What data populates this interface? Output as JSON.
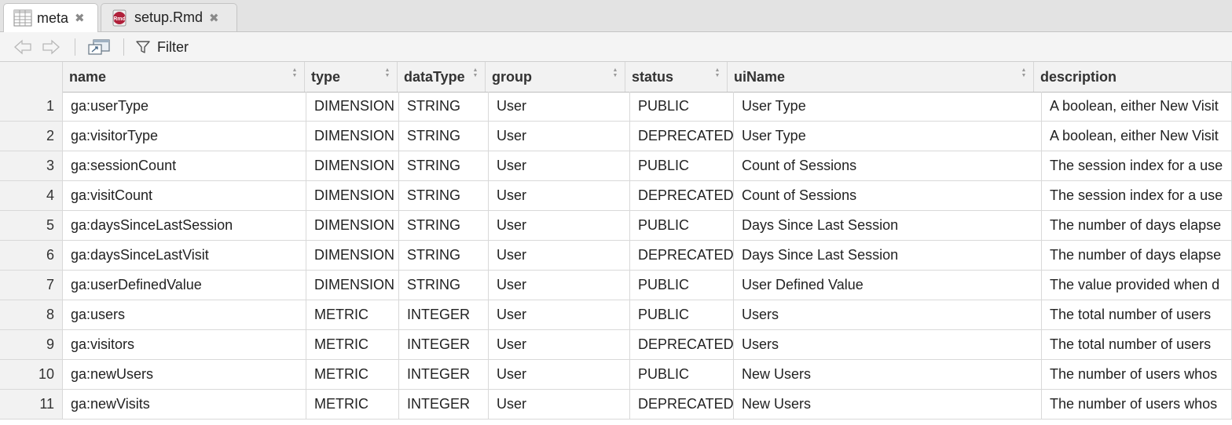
{
  "tabs": [
    {
      "label": "meta",
      "icon": "table-icon",
      "active": true
    },
    {
      "label": "setup.Rmd",
      "icon": "rmd-file-icon",
      "active": false
    }
  ],
  "toolbar": {
    "back_icon": "back-arrow-icon",
    "forward_icon": "forward-arrow-icon",
    "popout_icon": "popout-window-icon",
    "filter_label": "Filter"
  },
  "table": {
    "columns": [
      "name",
      "type",
      "dataType",
      "group",
      "status",
      "uiName",
      "description"
    ],
    "rows": [
      {
        "num": "1",
        "name": "ga:userType",
        "type": "DIMENSION",
        "dataType": "STRING",
        "group": "User",
        "status": "PUBLIC",
        "uiName": "User Type",
        "description": "A boolean, either New Visit"
      },
      {
        "num": "2",
        "name": "ga:visitorType",
        "type": "DIMENSION",
        "dataType": "STRING",
        "group": "User",
        "status": "DEPRECATED",
        "uiName": "User Type",
        "description": "A boolean, either New Visit"
      },
      {
        "num": "3",
        "name": "ga:sessionCount",
        "type": "DIMENSION",
        "dataType": "STRING",
        "group": "User",
        "status": "PUBLIC",
        "uiName": "Count of Sessions",
        "description": "The session index for a use"
      },
      {
        "num": "4",
        "name": "ga:visitCount",
        "type": "DIMENSION",
        "dataType": "STRING",
        "group": "User",
        "status": "DEPRECATED",
        "uiName": "Count of Sessions",
        "description": "The session index for a use"
      },
      {
        "num": "5",
        "name": "ga:daysSinceLastSession",
        "type": "DIMENSION",
        "dataType": "STRING",
        "group": "User",
        "status": "PUBLIC",
        "uiName": "Days Since Last Session",
        "description": "The number of days elapse"
      },
      {
        "num": "6",
        "name": "ga:daysSinceLastVisit",
        "type": "DIMENSION",
        "dataType": "STRING",
        "group": "User",
        "status": "DEPRECATED",
        "uiName": "Days Since Last Session",
        "description": "The number of days elapse"
      },
      {
        "num": "7",
        "name": "ga:userDefinedValue",
        "type": "DIMENSION",
        "dataType": "STRING",
        "group": "User",
        "status": "PUBLIC",
        "uiName": "User Defined Value",
        "description": "The value provided when d"
      },
      {
        "num": "8",
        "name": "ga:users",
        "type": "METRIC",
        "dataType": "INTEGER",
        "group": "User",
        "status": "PUBLIC",
        "uiName": "Users",
        "description": "The total number of users"
      },
      {
        "num": "9",
        "name": "ga:visitors",
        "type": "METRIC",
        "dataType": "INTEGER",
        "group": "User",
        "status": "DEPRECATED",
        "uiName": "Users",
        "description": "The total number of users"
      },
      {
        "num": "10",
        "name": "ga:newUsers",
        "type": "METRIC",
        "dataType": "INTEGER",
        "group": "User",
        "status": "PUBLIC",
        "uiName": "New Users",
        "description": "The number of users whos"
      },
      {
        "num": "11",
        "name": "ga:newVisits",
        "type": "METRIC",
        "dataType": "INTEGER",
        "group": "User",
        "status": "DEPRECATED",
        "uiName": "New Users",
        "description": "The number of users whos"
      }
    ]
  }
}
